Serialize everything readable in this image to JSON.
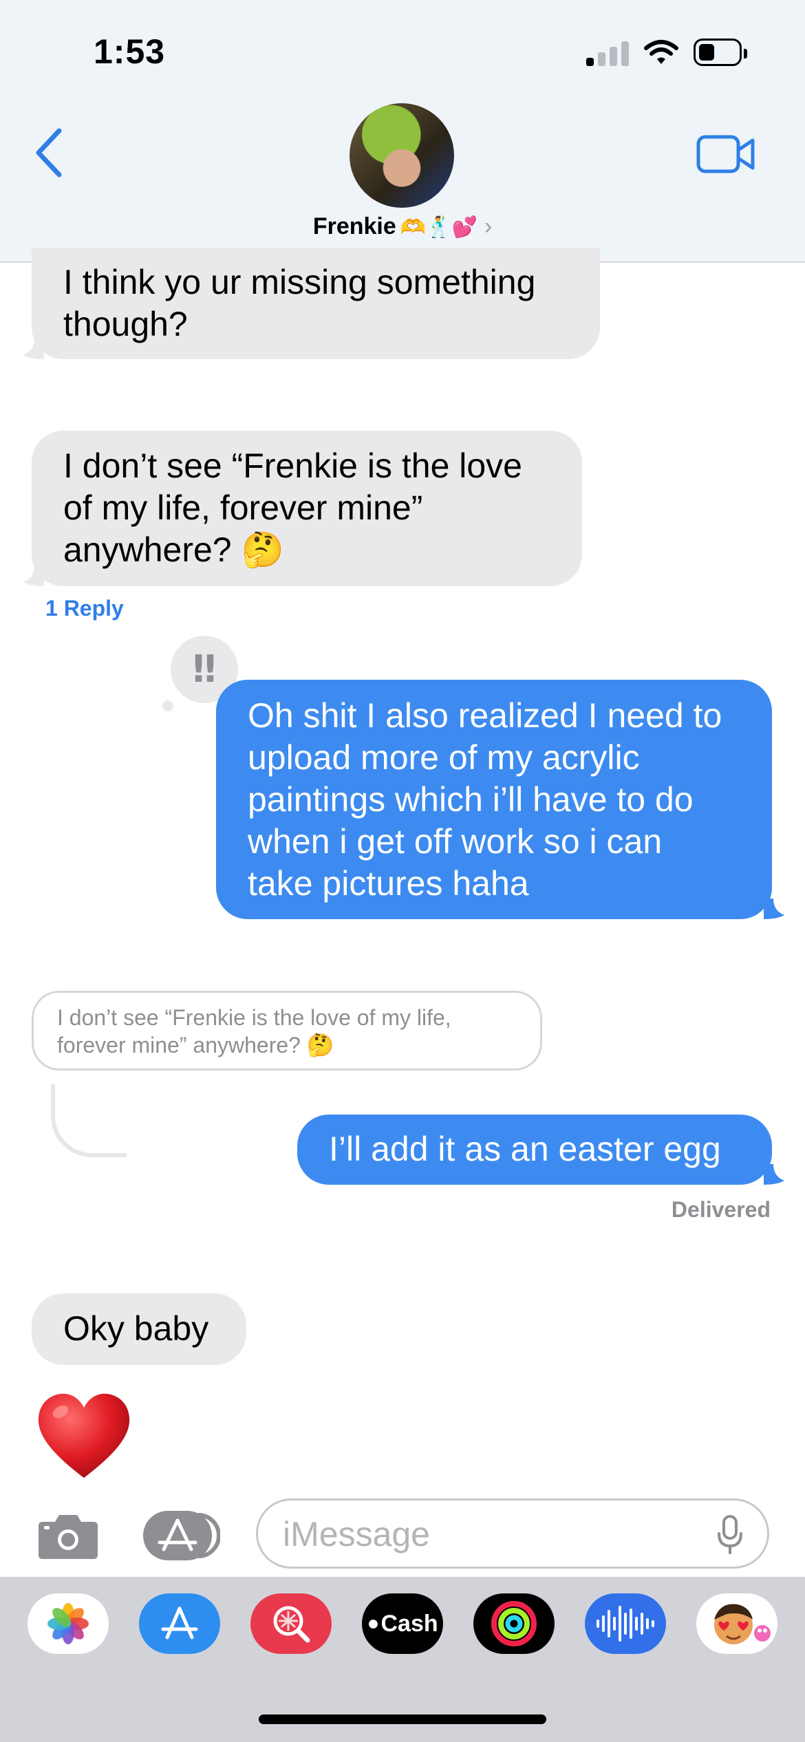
{
  "status_bar": {
    "time": "1:53"
  },
  "header": {
    "contact_name": "Frenkie",
    "name_emojis": "🫶🕺💕",
    "chevron": "›"
  },
  "messages": [
    {
      "id": "m1",
      "side": "received",
      "text_lines": [
        "I think yo ur missing something",
        "though?"
      ]
    },
    {
      "id": "m2",
      "side": "received",
      "text_lines": [
        "I don’t see “Frenkie is the love",
        "of my life, forever mine”",
        "anywhere? 🤔"
      ],
      "reply_count_label": "1 Reply"
    },
    {
      "id": "m3",
      "side": "sent",
      "tapback": "‼",
      "text_lines": [
        "Oh shit I also realized I need to",
        "upload more of my acrylic",
        "paintings which i’ll have to do",
        "when i get off work so i can",
        "take pictures haha"
      ]
    },
    {
      "id": "m4",
      "side": "sent",
      "quoted_lines": [
        "I don’t see “Frenkie is the love of my life,",
        "forever mine” anywhere? 🤔"
      ],
      "text_lines": [
        "I’ll add it as an easter egg"
      ],
      "status": "Delivered"
    },
    {
      "id": "m5",
      "side": "received",
      "text_lines": [
        "Oky baby"
      ]
    },
    {
      "id": "m6",
      "side": "received",
      "emoji": "❤️"
    }
  ],
  "input_bar": {
    "placeholder": "iMessage"
  },
  "app_drawer": [
    {
      "name": "Photos",
      "icon": "photos-icon"
    },
    {
      "name": "App Store",
      "icon": "app-store-icon"
    },
    {
      "name": "Images",
      "icon": "images-search-icon"
    },
    {
      "name": "Cash",
      "label": "Cash",
      "icon": "apple-cash-icon"
    },
    {
      "name": "Activity",
      "icon": "activity-rings-icon"
    },
    {
      "name": "Audio",
      "icon": "audio-message-icon"
    },
    {
      "name": "Memoji",
      "icon": "memoji-stickers-icon"
    }
  ],
  "colors": {
    "sent_bubble": "#3d8bf0",
    "received_bubble": "#e9e9eb",
    "accent": "#2f7fe6",
    "header_bg": "#eef4f8"
  }
}
